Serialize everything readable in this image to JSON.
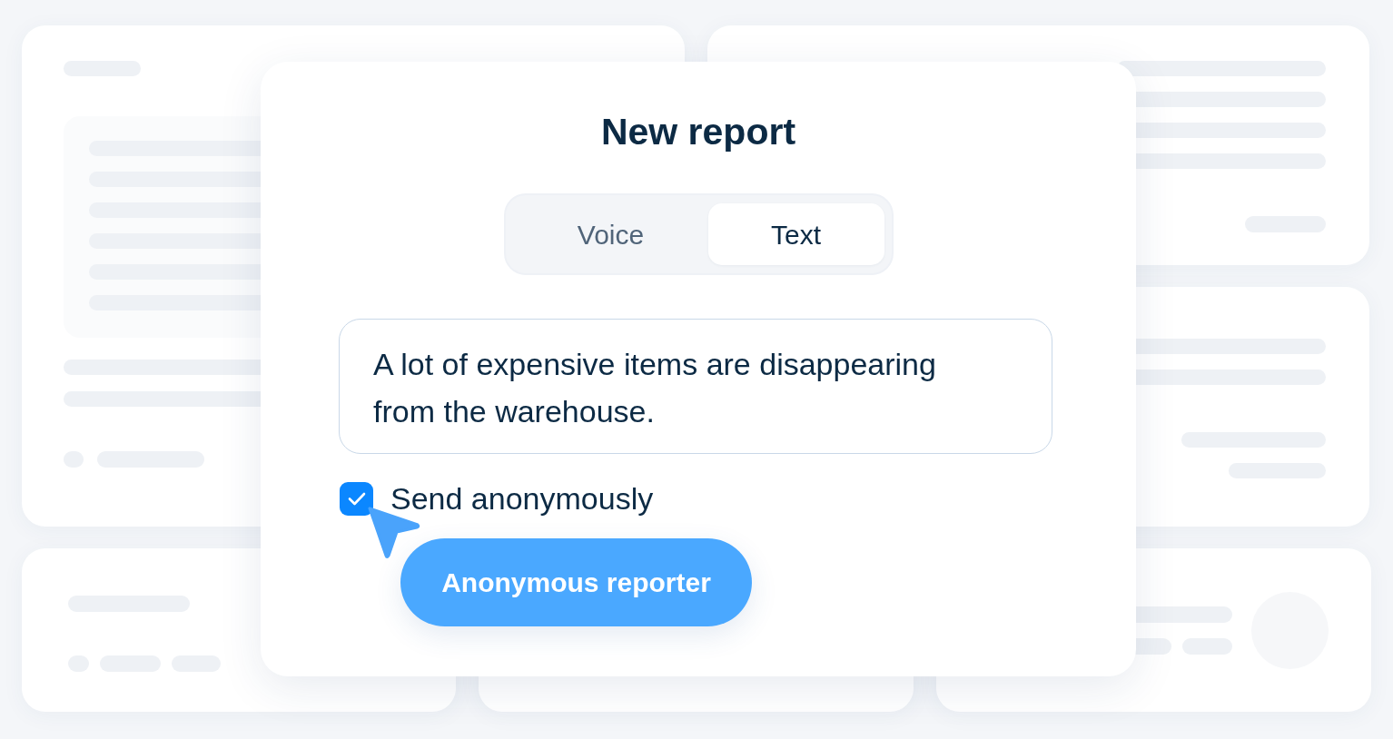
{
  "dialog": {
    "title": "New report"
  },
  "tabs": [
    {
      "label": "Voice",
      "selected": false
    },
    {
      "label": "Text",
      "selected": true
    }
  ],
  "report_field": {
    "value": "A lot of expensive items are disappearing from the warehouse."
  },
  "anonymous_option": {
    "label": "Send anonymously",
    "checked": true
  },
  "reporter_button": {
    "label": "Anonymous reporter"
  }
}
